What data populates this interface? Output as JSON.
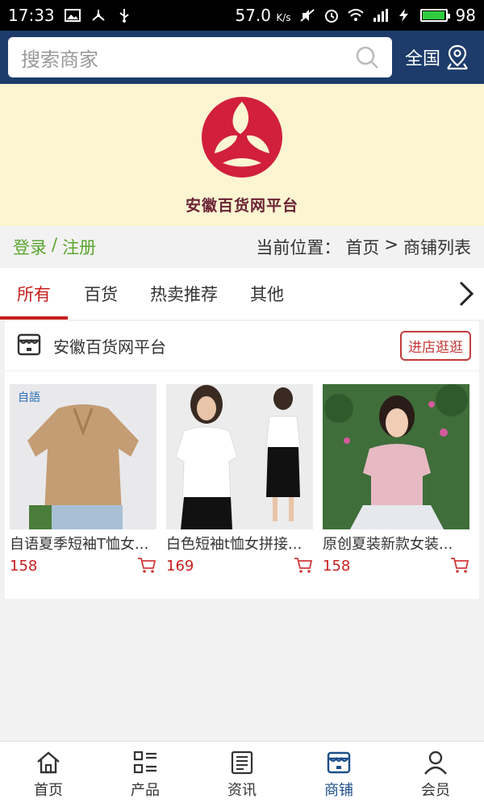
{
  "status_bar": {
    "time": "17:33",
    "speed": "57.0",
    "speed_unit": "K/s",
    "battery": "98",
    "battery_level": 0.98
  },
  "search": {
    "placeholder": "搜索商家",
    "region_label": "全国"
  },
  "banner": {
    "brand_text": "安徽百货网平台"
  },
  "nav_row": {
    "login": "登录",
    "separator": "/",
    "register": "注册",
    "location_prefix": "当前位置：",
    "crumb_home": "首页",
    "crumb_arrow": ">",
    "crumb_current": "商铺列表"
  },
  "tabs": [
    {
      "label": "所有",
      "active": true
    },
    {
      "label": "百货",
      "active": false
    },
    {
      "label": "热卖推荐",
      "active": false
    },
    {
      "label": "其他",
      "active": false
    }
  ],
  "shop": {
    "name": "安徽百货网平台",
    "enter_label": "进店逛逛",
    "products": [
      {
        "name": "自语夏季短袖T恤女...",
        "price": "158",
        "image": "beige-top-photo",
        "badge": "自語"
      },
      {
        "name": "白色短袖t恤女拼接...",
        "price": "169",
        "image": "white-top-photo"
      },
      {
        "name": "原创夏装新款女装...",
        "price": "158",
        "image": "pink-top-photo"
      }
    ]
  },
  "bottom_nav": [
    {
      "label": "首页",
      "icon": "home-icon",
      "active": false
    },
    {
      "label": "产品",
      "icon": "grid-list-icon",
      "active": false
    },
    {
      "label": "资讯",
      "icon": "news-icon",
      "active": false
    },
    {
      "label": "商铺",
      "icon": "store-icon",
      "active": true
    },
    {
      "label": "会员",
      "icon": "user-icon",
      "active": false
    }
  ],
  "colors": {
    "header_bg": "#1d3c6b",
    "banner_bg": "#fbf5d2",
    "accent_red": "#c81e1e",
    "login_green": "#5ba530",
    "nav_active": "#1d4e8a"
  }
}
